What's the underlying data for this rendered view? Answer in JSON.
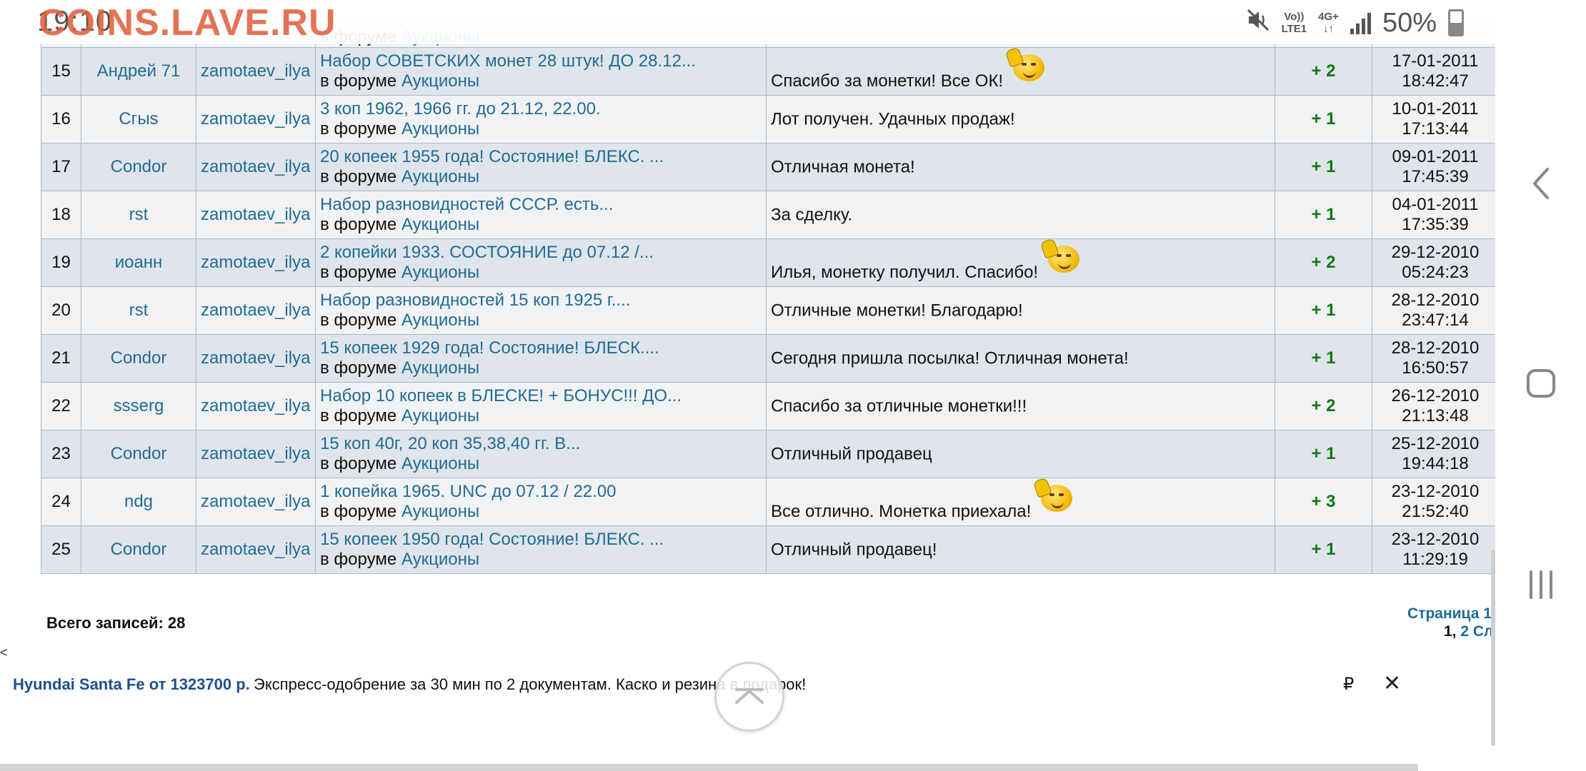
{
  "status_bar": {
    "time": "19:10",
    "watermark": "COINS.LAVE.RU",
    "volte_top": "Vo))",
    "volte_bottom": "LTE1",
    "network": "4G+",
    "battery": "50%"
  },
  "table": {
    "forum_prefix": "в форуме",
    "rows": [
      {
        "num": "15",
        "from": "Андрей 71",
        "to": "zamotaev_ilya",
        "topic": "Набор СОВЕТСКИХ монет 28 штук! ДО 28.12...",
        "forum": "Аукционы",
        "comment": "Спасибо за монетки! Все ОК!",
        "smiley": true,
        "score": "+ 2",
        "date": "17-01-2011",
        "time": "18:42:47"
      },
      {
        "num": "16",
        "from": "Сгыs",
        "to": "zamotaev_ilya",
        "topic": "3 коп 1962, 1966 гг. до 21.12, 22.00.",
        "forum": "Аукционы",
        "comment": "Лот получен. Удачных продаж!",
        "smiley": false,
        "score": "+ 1",
        "date": "10-01-2011",
        "time": "17:13:44"
      },
      {
        "num": "17",
        "from": "Condor",
        "to": "zamotaev_ilya",
        "topic": "20 копеек 1955 года! Состояние! БЛЕКС. ...",
        "forum": "Аукционы",
        "comment": "Отличная монета!",
        "smiley": false,
        "score": "+ 1",
        "date": "09-01-2011",
        "time": "17:45:39"
      },
      {
        "num": "18",
        "from": "rst",
        "to": "zamotaev_ilya",
        "topic": "Набор разновидностей СССР. есть...",
        "forum": "Аукционы",
        "comment": "За сделку.",
        "smiley": false,
        "score": "+ 1",
        "date": "04-01-2011",
        "time": "17:35:39"
      },
      {
        "num": "19",
        "from": "иоанн",
        "to": "zamotaev_ilya",
        "topic": "2 копейки 1933. СОСТОЯНИЕ до 07.12 /...",
        "forum": "Аукционы",
        "comment": "Илья, монетку получил. Спасибо!",
        "smiley": true,
        "score": "+ 2",
        "date": "29-12-2010",
        "time": "05:24:23"
      },
      {
        "num": "20",
        "from": "rst",
        "to": "zamotaev_ilya",
        "topic": "Набор разновидностей 15 коп 1925 г....",
        "forum": "Аукционы",
        "comment": "Отличные монетки! Благодарю!",
        "smiley": false,
        "score": "+ 1",
        "date": "28-12-2010",
        "time": "23:47:14"
      },
      {
        "num": "21",
        "from": "Condor",
        "to": "zamotaev_ilya",
        "topic": "15 копеек 1929 года! Состояние! БЛЕСК....",
        "forum": "Аукционы",
        "comment": "Сегодня пришла посылка! Отличная монета!",
        "smiley": false,
        "score": "+ 1",
        "date": "28-12-2010",
        "time": "16:50:57"
      },
      {
        "num": "22",
        "from": "ssserg",
        "to": "zamotaev_ilya",
        "topic": "Набор 10 копеек в БЛЕСКЕ! + БОНУС!!! ДО...",
        "forum": "Аукционы",
        "comment": "Спасибо за отличные монетки!!!",
        "smiley": false,
        "score": "+ 2",
        "date": "26-12-2010",
        "time": "21:13:48"
      },
      {
        "num": "23",
        "from": "Condor",
        "to": "zamotaev_ilya",
        "topic": "15 коп 40г, 20 коп 35,38,40 гг. В...",
        "forum": "Аукционы",
        "comment": "Отличный продавец",
        "smiley": false,
        "score": "+ 1",
        "date": "25-12-2010",
        "time": "19:44:18"
      },
      {
        "num": "24",
        "from": "ndg",
        "to": "zamotaev_ilya",
        "topic": "1 копейка 1965. UNC до 07.12 / 22.00",
        "forum": "Аукционы",
        "comment": "Все отлично. Монетка приехала!",
        "smiley": true,
        "score": "+ 3",
        "date": "23-12-2010",
        "time": "21:52:40"
      },
      {
        "num": "25",
        "from": "Condor",
        "to": "zamotaev_ilya",
        "topic": "15 копеек 1950 года! Состояние! БЛЕКС. ...",
        "forum": "Аукционы",
        "comment": "Отличный продавец!",
        "smiley": false,
        "score": "+ 1",
        "date": "23-12-2010",
        "time": "11:29:19"
      }
    ]
  },
  "footer": {
    "total": "Всего записей: 28",
    "pages_label": "Страница 1",
    "page_current": "1,",
    "page_next": "2",
    "page_next_label": "Сл"
  },
  "ad": {
    "left_caret": "<",
    "title": "Hyundai Santa Fe от 1323700 р.",
    "text": "Экспресс-одобрение за 30 мин по 2 документам. Каско и резина в подарок!",
    "currency": "₽",
    "close": "✕"
  },
  "colors": {
    "link": "#1f6c95",
    "score": "#0f7a0f",
    "row_odd": "#dfe5eb",
    "row_even": "#f1f2f4",
    "watermark": "#e0623f"
  }
}
